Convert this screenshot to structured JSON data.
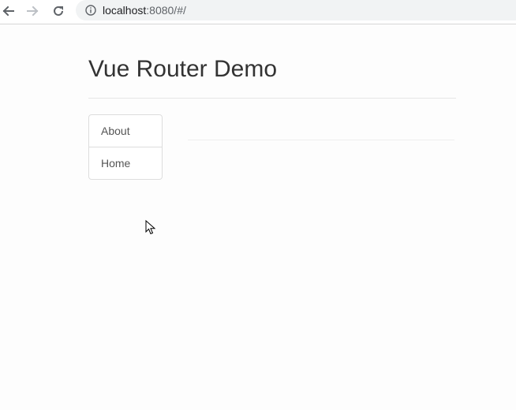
{
  "browser": {
    "url_host": "localhost",
    "url_rest": ":8080/#/",
    "back_icon": "arrow-left-icon",
    "forward_icon": "arrow-right-icon",
    "reload_icon": "reload-icon",
    "info_icon": "info-icon"
  },
  "page": {
    "title": "Vue Router Demo",
    "nav_items": [
      {
        "label": "About"
      },
      {
        "label": "Home"
      }
    ]
  },
  "colors": {
    "text": "#333333",
    "nav_text": "#555555",
    "border": "#dddddd",
    "omnibox_bg": "#f1f3f4"
  }
}
